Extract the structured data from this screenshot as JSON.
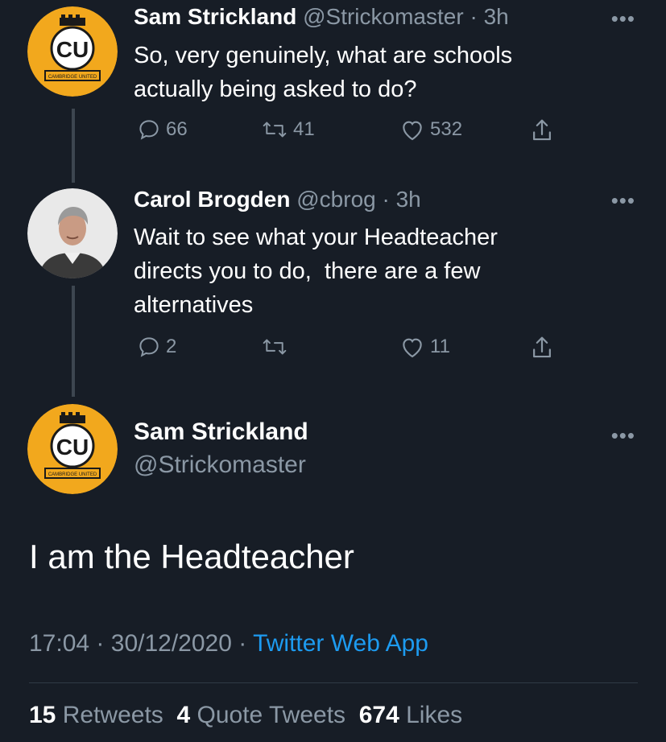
{
  "tweet1": {
    "name": "Sam Strickland",
    "handle": "@Strickomaster",
    "time": "3h",
    "text_line1": "So, very genuinely, what are schools",
    "text_line2": "actually being asked to do?",
    "replies": "66",
    "retweets": "41",
    "likes": "532",
    "avatar_icon": "cambridge-united-badge"
  },
  "tweet2": {
    "name": "Carol Brogden",
    "handle": "@cbrog",
    "time": "3h",
    "text_line1": "Wait to see what your Headteacher",
    "text_line2": "directs you to do,  there are a few",
    "text_line3": "alternatives",
    "replies": "2",
    "likes": "11",
    "avatar_icon": "profile-photo"
  },
  "main": {
    "name": "Sam Strickland",
    "handle": "@Strickomaster",
    "text": "I am the Headteacher",
    "time": "17:04",
    "date": "30/12/2020",
    "app": "Twitter Web App",
    "retweets_count": "15",
    "retweets_label": "Retweets",
    "quotes_count": "4",
    "quotes_label": "Quote Tweets",
    "likes_count": "674",
    "likes_label": "Likes"
  },
  "separator": "·",
  "more_glyph": "•••",
  "badge_text": "CU",
  "badge_banner": "CAMBRIDGE UNITED",
  "colors": {
    "background": "#171d26",
    "muted": "#8b98a5",
    "link": "#1d9bf0",
    "badge_amber": "#f2a81d"
  }
}
